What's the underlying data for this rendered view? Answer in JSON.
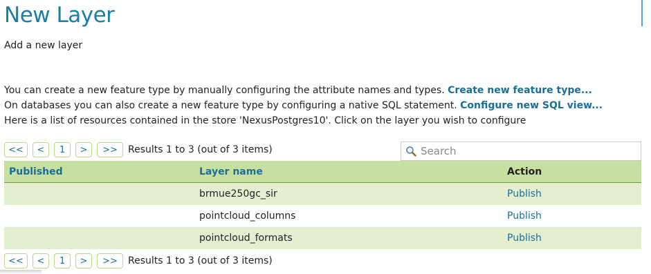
{
  "header": {
    "title": "New Layer",
    "subtitle": "Add a new layer"
  },
  "intro": {
    "line1_text": "You can create a new feature type by manually configuring the attribute names and types. ",
    "line1_link": "Create new feature type...",
    "line2_text": "On databases you can also create a new feature type by configuring a native SQL statement. ",
    "line2_link": "Configure new SQL view...",
    "line3_text": "Here is a list of resources contained in the store 'NexusPostgres10'. Click on the layer you wish to configure"
  },
  "pager": {
    "first": "<<",
    "prev": "<",
    "page": "1",
    "next": ">",
    "last": ">>",
    "info": "Results 1 to 3 (out of 3 items)"
  },
  "search": {
    "placeholder": "Search",
    "value": ""
  },
  "table": {
    "columns": [
      "Published",
      "Layer name",
      "Action"
    ],
    "rows": [
      {
        "published": "",
        "layer_name": "brmue250gc_sir",
        "action": "Publish"
      },
      {
        "published": "",
        "layer_name": "pointcloud_columns",
        "action": "Publish"
      },
      {
        "published": "",
        "layer_name": "pointcloud_formats",
        "action": "Publish"
      }
    ]
  },
  "icons": {
    "search": "magnifier-icon"
  },
  "colors": {
    "title": "#1a7fa8",
    "link": "#1a6f99",
    "header_bg": "#c7e09f",
    "row_alt_bg": "#e3efd0"
  }
}
